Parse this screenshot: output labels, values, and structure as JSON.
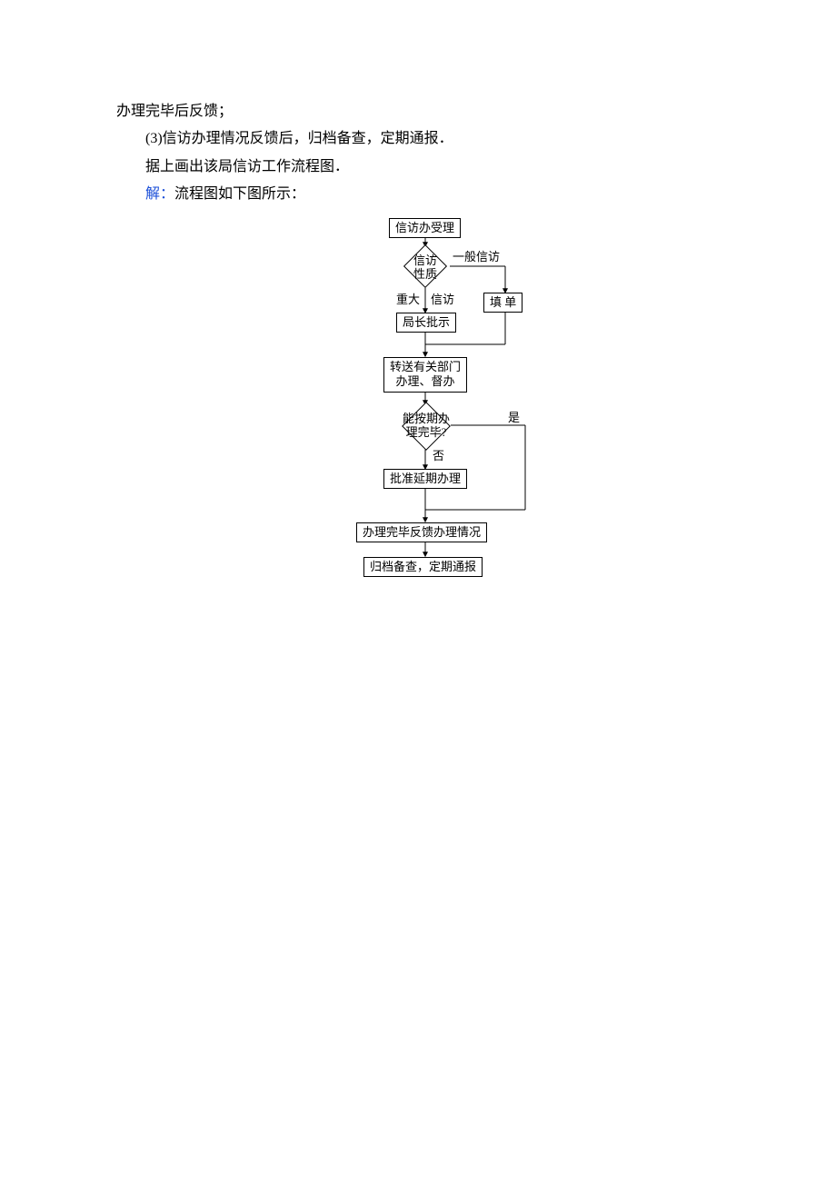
{
  "text": {
    "line1": "办理完毕后反馈；",
    "line2": "(3)信访办理情况反馈后，归档备查，定期通报．",
    "line3": "据上画出该局信访工作流程图．",
    "solve_label": "解：",
    "line4_tail": "流程图如下图所示："
  },
  "flow": {
    "n1": "信访办受理",
    "n2": "信访性质",
    "n2_right": "一般信访",
    "n2_down": "重大",
    "n2_down2": "信访",
    "n3": "填  单",
    "n4": "局长批示",
    "n5a": "转送有关部门",
    "n5b": "办理、督办",
    "n6a": "能按期办",
    "n6b": "理完毕?",
    "n6_right": "是",
    "n6_down": "否",
    "n7": "批准延期办理",
    "n8": "办理完毕反馈办理情况",
    "n9": "归档备查，定期通报"
  }
}
